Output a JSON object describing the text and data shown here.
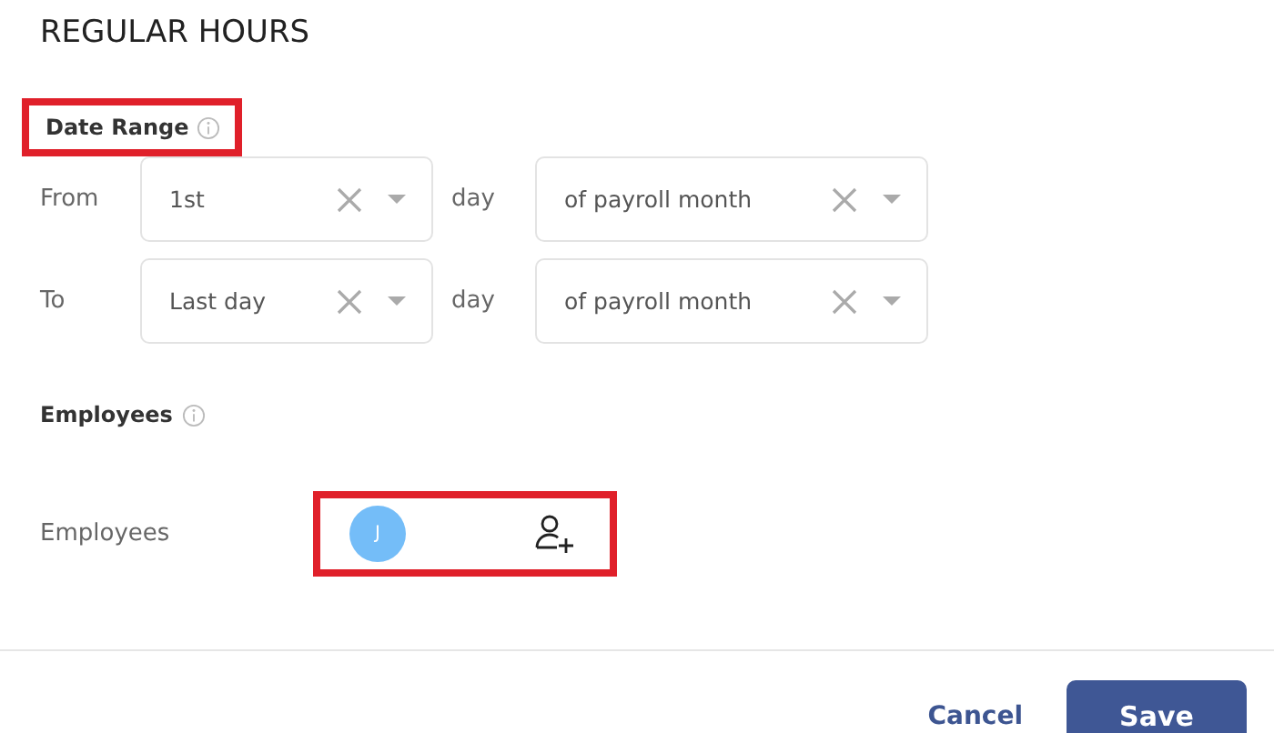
{
  "title": "REGULAR HOURS",
  "date_range": {
    "heading": "Date Range",
    "highlighted": true,
    "rows": [
      {
        "label": "From",
        "first": {
          "value": "1st"
        },
        "unit": "day",
        "second": {
          "value": "of payroll month"
        }
      },
      {
        "label": "To",
        "first": {
          "value": "Last day"
        },
        "unit": "day",
        "second": {
          "value": "of payroll month"
        }
      }
    ]
  },
  "employees": {
    "heading": "Employees",
    "field_label": "Employees",
    "highlighted": true,
    "avatars": [
      {
        "initial": "J",
        "color": "#74bdf8"
      }
    ]
  },
  "buttons": {
    "cancel": "Cancel",
    "save": "Save"
  }
}
